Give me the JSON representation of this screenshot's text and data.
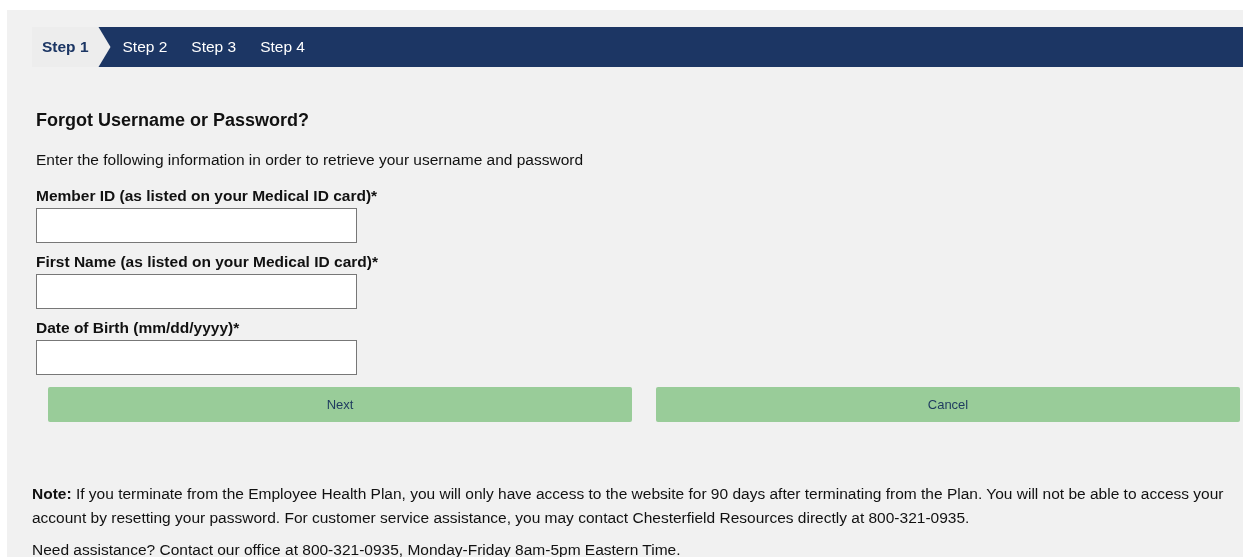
{
  "steps": [
    {
      "label": "Step 1",
      "selected": true
    },
    {
      "label": "Step 2",
      "selected": false
    },
    {
      "label": "Step 3",
      "selected": false
    },
    {
      "label": "Step 4",
      "selected": false
    }
  ],
  "title": "Forgot Username or Password?",
  "intro": "Enter the following information in order to retrieve your username and password",
  "fields": [
    {
      "label": "Member ID (as listed on your Medical ID card)*"
    },
    {
      "label": "First Name (as listed on your Medical ID card)*"
    },
    {
      "label": "Date of Birth (mm/dd/yyyy)*"
    }
  ],
  "buttons": [
    "Next",
    "Cancel"
  ],
  "note_lines": [
    "**Note:** If you terminate from the Employee Health Plan, you will only have access to the website for 90 days after terminating from the Plan. You will not be able to access your",
    "account by resetting your password. For customer service assistance, you may contact Chesterfield Resources directly at 800-321-0935."
  ],
  "assistance": "Need assistance? Contact our office at 800-321-0935, Monday-Friday 8am-5pm Eastern Time."
}
